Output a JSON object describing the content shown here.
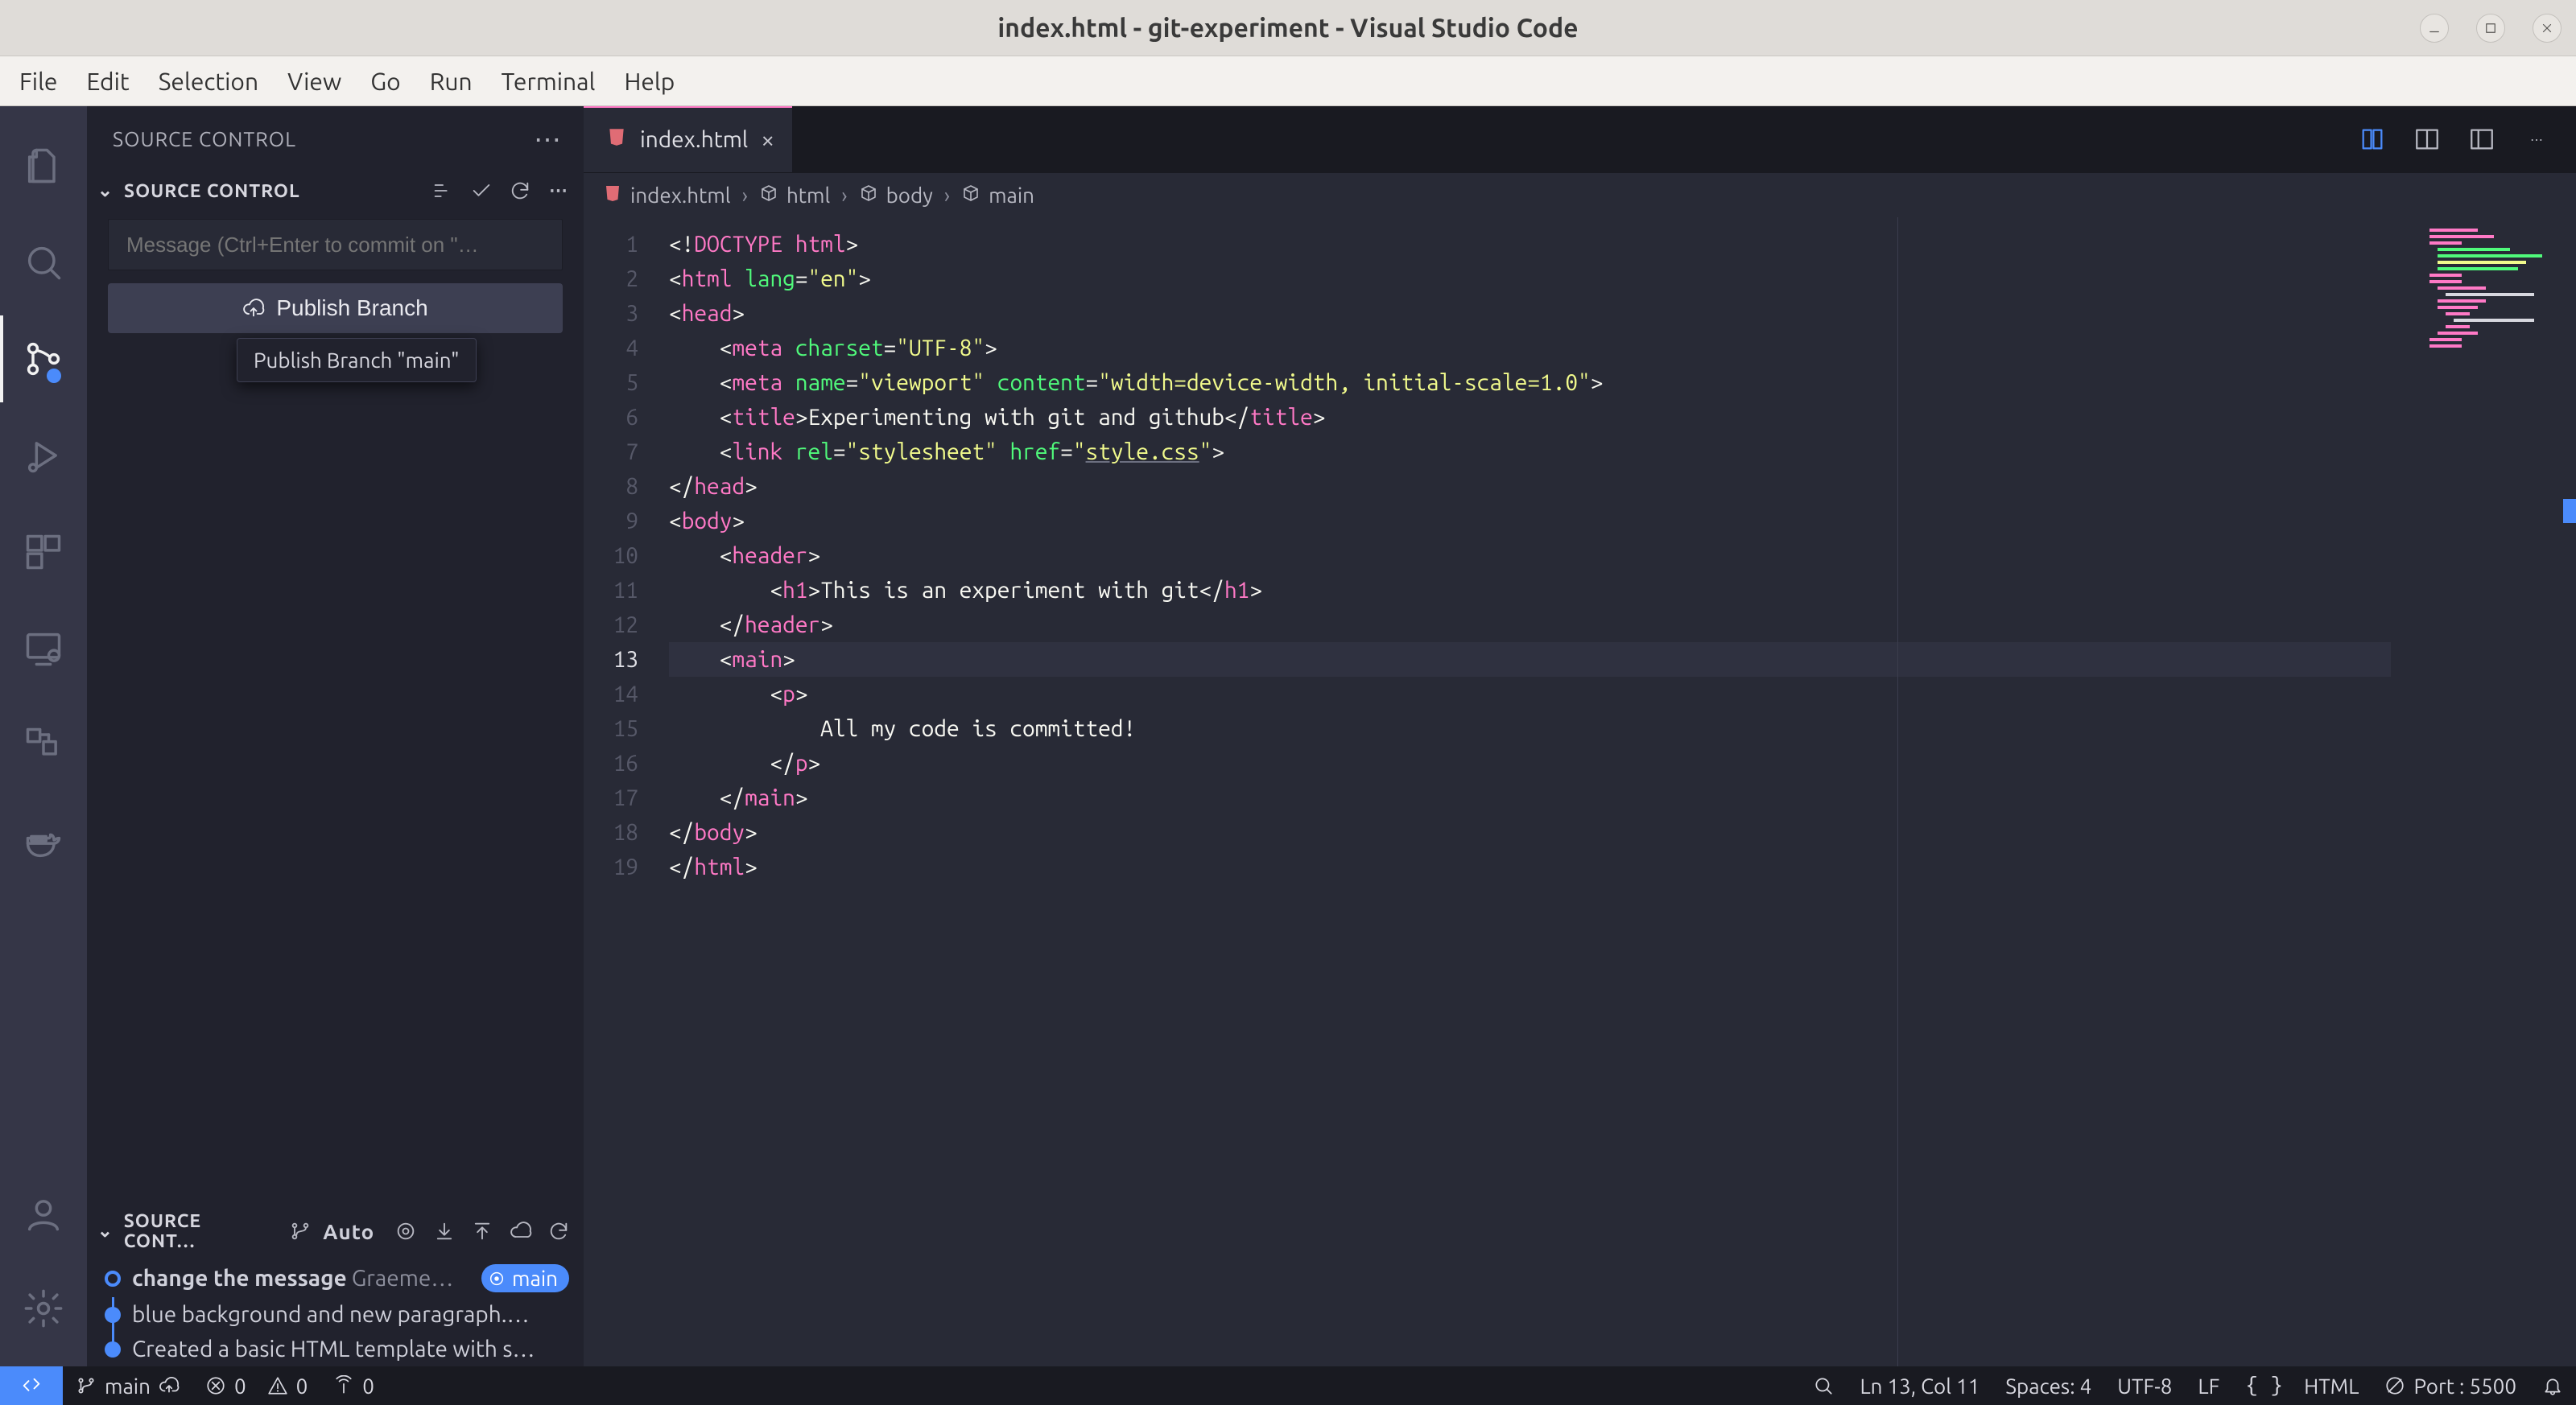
{
  "os": {
    "title": "index.html - git-experiment - Visual Studio Code"
  },
  "menubar": [
    "File",
    "Edit",
    "Selection",
    "View",
    "Go",
    "Run",
    "Terminal",
    "Help"
  ],
  "sidebar": {
    "title": "SOURCE CONTROL",
    "section1": "SOURCE CONTROL",
    "message_placeholder": "Message (Ctrl+Enter to commit on \"…",
    "publish_label": "Publish Branch",
    "tooltip": "Publish Branch \"main\"",
    "section2": "SOURCE CONT…",
    "section2_mode": "Auto",
    "commits": [
      {
        "msg_bold": "change the message",
        "author": "Graeme…",
        "branch": "main"
      },
      {
        "msg": "blue background and new paragraph.…"
      },
      {
        "msg": "Created a basic HTML template with s…"
      }
    ]
  },
  "tab": {
    "filename": "index.html"
  },
  "breadcrumb": [
    "index.html",
    "html",
    "body",
    "main"
  ],
  "code_lines": 19,
  "code": {
    "l1": {
      "pre": "<!",
      "kw": "DOCTYPE html",
      "post": ">"
    },
    "l2": {
      "open": "<",
      "tag": "html",
      "sp": " ",
      "attr": "lang",
      "eq": "=",
      "val": "\"en\"",
      "close": ">"
    },
    "l3": {
      "open": "<",
      "tag": "head",
      "close": ">"
    },
    "l4": {
      "open": "<",
      "tag": "meta",
      "sp": " ",
      "attr": "charset",
      "eq": "=",
      "val": "\"UTF-8\"",
      "close": ">"
    },
    "l5": {
      "open": "<",
      "tag": "meta",
      "sp": " ",
      "attr1": "name",
      "eq": "=",
      "val1": "\"viewport\"",
      "sp2": " ",
      "attr2": "content",
      "val2": "\"width=device-width, initial-scale=1.0\"",
      "close": ">"
    },
    "l6": {
      "open": "<",
      "tag": "title",
      "close1": ">",
      "text": "Experimenting with git and github",
      "open2": "</",
      "tag2": "title",
      "close2": ">"
    },
    "l7": {
      "open": "<",
      "tag": "link",
      "sp": " ",
      "attr1": "rel",
      "val1": "\"stylesheet\"",
      "sp2": " ",
      "attr2": "href",
      "val2": "\"",
      "linktext": "style.css",
      "val2b": "\"",
      "close": ">"
    },
    "l8": {
      "open": "</",
      "tag": "head",
      "close": ">"
    },
    "l9": {
      "open": "<",
      "tag": "body",
      "close": ">"
    },
    "l10": {
      "open": "<",
      "tag": "header",
      "close": ">"
    },
    "l11": {
      "open": "<",
      "tag": "h1",
      "close1": ">",
      "text": "This is an experiment with git",
      "open2": "</",
      "tag2": "h1",
      "close2": ">"
    },
    "l12": {
      "open": "</",
      "tag": "header",
      "close": ">"
    },
    "l13": {
      "open": "<",
      "tag": "main",
      "close": ">"
    },
    "l14": {
      "open": "<",
      "tag": "p",
      "close": ">"
    },
    "l15": {
      "text": "All my code is committed!"
    },
    "l16": {
      "open": "</",
      "tag": "p",
      "close": ">"
    },
    "l17": {
      "open": "</",
      "tag": "main",
      "close": ">"
    },
    "l18": {
      "open": "</",
      "tag": "body",
      "close": ">"
    },
    "l19": {
      "open": "</",
      "tag": "html",
      "close": ">"
    }
  },
  "status": {
    "branch": "main",
    "errors": "0",
    "warnings": "0",
    "ports": "0",
    "cursor": "Ln 13, Col 11",
    "spaces": "Spaces: 4",
    "encoding": "UTF-8",
    "eol": "LF",
    "lang": "HTML",
    "liveserver": "Port : 5500"
  }
}
